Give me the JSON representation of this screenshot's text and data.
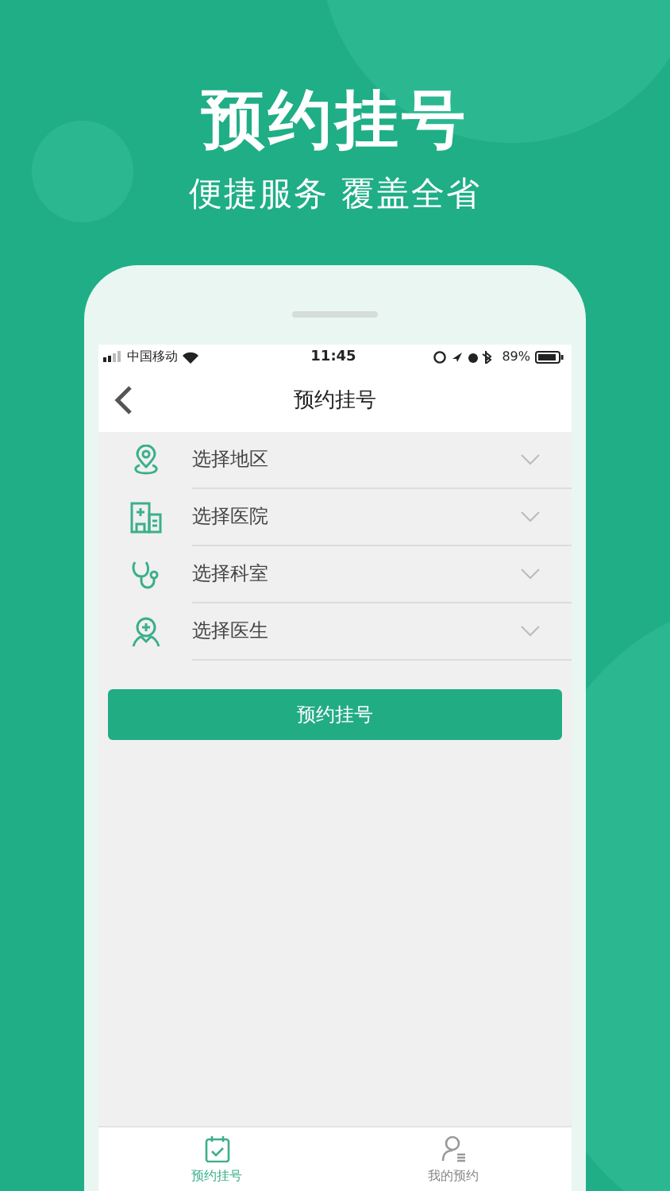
{
  "header": {
    "title": "预约挂号",
    "subtitle": "便捷服务 覆盖全省"
  },
  "status_bar": {
    "carrier": "中国移动",
    "time": "11:45",
    "battery": "89%"
  },
  "nav": {
    "title": "预约挂号"
  },
  "form_items": [
    {
      "kind": "region",
      "label": "选择地区"
    },
    {
      "kind": "hospital",
      "label": "选择医院"
    },
    {
      "kind": "department",
      "label": "选择科室"
    },
    {
      "kind": "doctor",
      "label": "选择医生"
    }
  ],
  "submit_button": "预约挂号",
  "tabs": [
    {
      "kind": "booking",
      "label": "预约挂号",
      "selected": true
    },
    {
      "kind": "mine",
      "label": "我的预约",
      "selected": false
    }
  ]
}
